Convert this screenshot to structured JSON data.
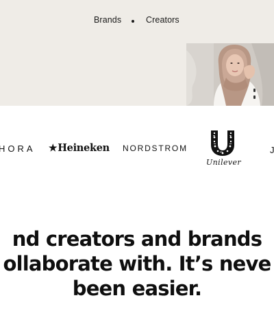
{
  "nav": {
    "brands_label": "Brands",
    "creators_label": "Creators"
  },
  "logos": {
    "sephora": "HORA",
    "heineken": "Heineken",
    "nordstrom": "NORDSTROM",
    "unilever": "Unilever",
    "partial": "J"
  },
  "headline": {
    "line1": "nd creators and brands",
    "line2": "ollaborate with. It’s neve",
    "line3": "been easier."
  },
  "colors": {
    "hero_background": "#efece7",
    "text": "#111111"
  },
  "icons": {
    "star": "star-icon",
    "unilever_mark": "unilever-u-icon"
  }
}
